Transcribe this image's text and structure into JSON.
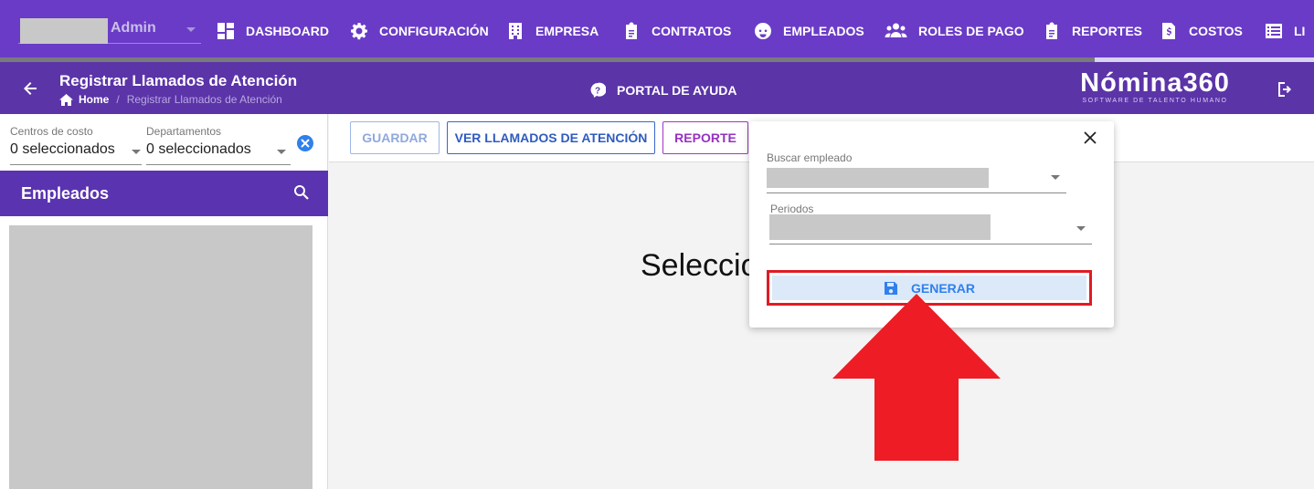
{
  "topnav": {
    "user_label": "Admin",
    "items": [
      {
        "label": "DASHBOARD",
        "icon": "dashboard-icon"
      },
      {
        "label": "CONFIGURACIÓN",
        "icon": "gear-icon"
      },
      {
        "label": "EMPRESA",
        "icon": "building-icon"
      },
      {
        "label": "CONTRATOS",
        "icon": "clipboard-icon"
      },
      {
        "label": "EMPLEADOS",
        "icon": "face-icon"
      },
      {
        "label": "ROLES DE PAGO",
        "icon": "group-icon"
      },
      {
        "label": "REPORTES",
        "icon": "clipboard-icon"
      },
      {
        "label": "COSTOS",
        "icon": "invoice-icon"
      },
      {
        "label": "LI",
        "icon": "list-icon"
      }
    ]
  },
  "header": {
    "title": "Registrar Llamados de Atención",
    "breadcrumb": {
      "home": "Home",
      "current": "Registrar Llamados de Atención"
    },
    "help_label": "PORTAL DE AYUDA",
    "brand_name": "Nómina360",
    "brand_tagline": "SOFTWARE DE TALENTO HUMANO"
  },
  "filters": {
    "cost_centers": {
      "label": "Centros de costo",
      "value": "0 seleccionados"
    },
    "departments": {
      "label": "Departamentos",
      "value": "0 seleccionados"
    }
  },
  "employees_panel": {
    "title": "Empleados"
  },
  "toolbar": {
    "guardar": "GUARDAR",
    "ver": "VER LLAMADOS DE ATENCIÓN",
    "reporte": "REPORTE"
  },
  "main": {
    "placeholder_text": "Seleccio"
  },
  "popup": {
    "employee_label": "Buscar empleado",
    "periods_label": "Periodos",
    "generate_label": "GENERAR"
  },
  "colors": {
    "nav": "#6a3bc6",
    "header": "#5b34a8",
    "highlight": "#e01b24",
    "arrow": "#ee1c25"
  }
}
